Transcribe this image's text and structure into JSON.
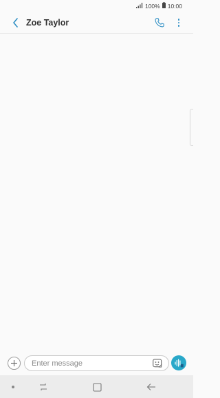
{
  "status_bar": {
    "signal_icon": "signal-bars-icon",
    "battery_percent": "100%",
    "battery_icon": "battery-icon",
    "time": "10:00"
  },
  "header": {
    "back_icon": "chevron-left-icon",
    "contact_name": "Zoe Taylor",
    "call_icon": "phone-icon",
    "more_icon": "more-vertical-icon"
  },
  "composer": {
    "add_icon": "plus-icon",
    "placeholder": "Enter message",
    "value": "",
    "sticker_icon": "sticker-icon",
    "voice_icon": "voice-wave-icon"
  },
  "nav_bar": {
    "items": [
      "dot-icon",
      "recent-apps-icon",
      "home-icon",
      "back-arrow-icon"
    ]
  },
  "colors": {
    "accent": "#2f8fc4",
    "voice_button": "#29a8c9",
    "background": "#fafafa",
    "nav_background": "#ececec"
  }
}
